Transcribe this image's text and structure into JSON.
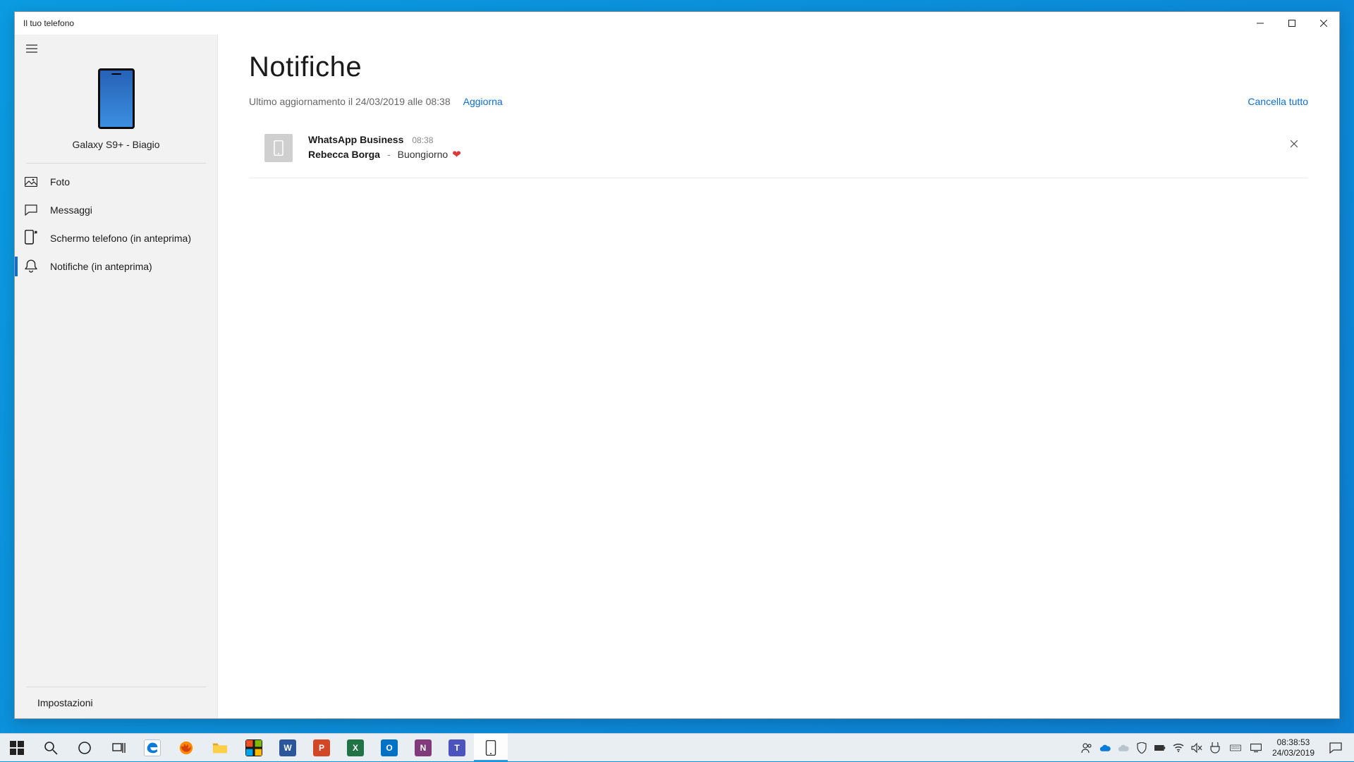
{
  "window": {
    "title": "Il tuo telefono"
  },
  "sidebar": {
    "device_name": "Galaxy S9+ - Biagio",
    "items": [
      {
        "label": "Foto",
        "icon": "photo-icon"
      },
      {
        "label": "Messaggi",
        "icon": "chat-icon"
      },
      {
        "label": "Schermo telefono (in anteprima)",
        "icon": "phone-screen-icon"
      },
      {
        "label": "Notifiche (in anteprima)",
        "icon": "bell-icon"
      }
    ],
    "settings_label": "Impostazioni"
  },
  "main": {
    "title": "Notifiche",
    "last_update": "Ultimo aggiornamento il 24/03/2019 alle 08:38",
    "refresh_label": "Aggiorna",
    "clear_all_label": "Cancella tutto"
  },
  "notifications": [
    {
      "app": "WhatsApp Business",
      "time": "08:38",
      "sender": "Rebecca Borga",
      "separator": "-",
      "message": "Buongiorno",
      "emoji": "❤"
    }
  ],
  "taskbar": {
    "clock_time": "08:38:53",
    "clock_date": "24/03/2019"
  }
}
